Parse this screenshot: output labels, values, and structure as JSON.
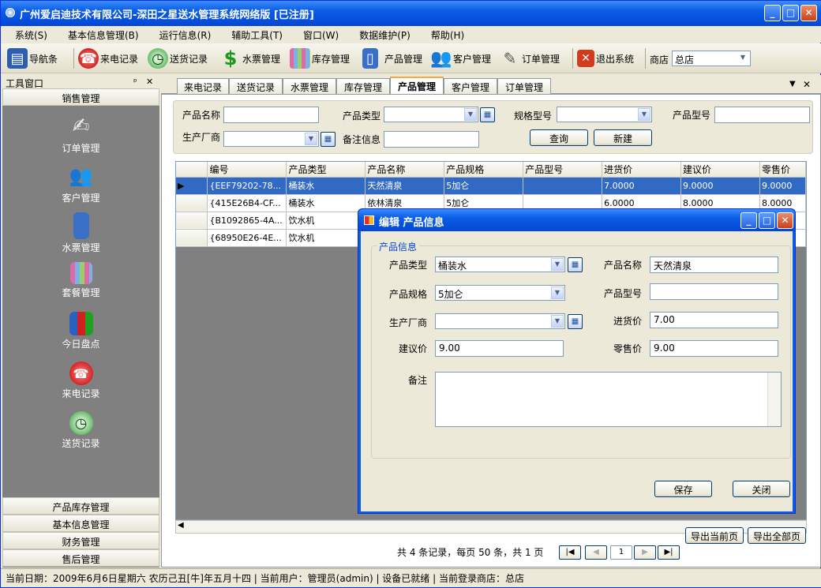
{
  "window": {
    "title": "广州爱启迪技术有限公司-深田之星送水管理系统网络版 [已注册]"
  },
  "menu": [
    "系统(S)",
    "基本信息管理(B)",
    "运行信息(R)",
    "辅助工具(T)",
    "窗口(W)",
    "数据维护(P)",
    "帮助(H)"
  ],
  "toolbar": {
    "nav": "导航条",
    "calls": "来电记录",
    "delivery": "送货记录",
    "tickets": "水票管理",
    "stock": "库存管理",
    "products": "产品管理",
    "customers": "客户管理",
    "orders": "订单管理",
    "exit": "退出系统",
    "store_label": "商店",
    "store_value": "总店"
  },
  "left_panel": {
    "title": "工具窗口",
    "group_active": "销售管理",
    "items": [
      "订单管理",
      "客户管理",
      "水票管理",
      "套餐管理",
      "今日盘点",
      "来电记录",
      "送货记录"
    ],
    "groups_bottom": [
      "产品库存管理",
      "基本信息管理",
      "财务管理",
      "售后管理"
    ]
  },
  "tabs": [
    "来电记录",
    "送货记录",
    "水票管理",
    "库存管理",
    "产品管理",
    "客户管理",
    "订单管理"
  ],
  "filter": {
    "name_label": "产品名称",
    "type_label": "产品类型",
    "spec_label": "规格型号",
    "model_label": "产品型号",
    "maker_label": "生产厂商",
    "note_label": "备注信息",
    "query": "查询",
    "new": "新建"
  },
  "grid": {
    "headers": [
      "编号",
      "产品类型",
      "产品名称",
      "产品规格",
      "产品型号",
      "进货价",
      "建议价",
      "零售价"
    ],
    "rows": [
      [
        "{EEF79202-78...",
        "桶装水",
        "天然清泉",
        "5加仑",
        "",
        "7.0000",
        "9.0000",
        "9.0000"
      ],
      [
        "{415E26B4-CF...",
        "桶装水",
        "依林清泉",
        "5加仑",
        "",
        "6.0000",
        "8.0000",
        "8.0000"
      ],
      [
        "{B1092865-4A...",
        "饮水机",
        "",
        "",
        "",
        "",
        "",
        ""
      ],
      [
        "{68950E26-4E...",
        "饮水机",
        "",
        "",
        "",
        "",
        "",
        ""
      ]
    ]
  },
  "pager": {
    "summary": "共 4 条记录，每页 50 条，共 1 页",
    "page": "1",
    "export_page": "导出当前页",
    "export_all": "导出全部页"
  },
  "dialog": {
    "title": "编辑 产品信息",
    "group": "产品信息",
    "type_label": "产品类型",
    "type_value": "桶装水",
    "name_label": "产品名称",
    "name_value": "天然清泉",
    "spec_label": "产品规格",
    "spec_value": "5加仑",
    "model_label": "产品型号",
    "model_value": "",
    "maker_label": "生产厂商",
    "maker_value": "",
    "cost_label": "进货价",
    "cost_value": "7.00",
    "suggest_label": "建议价",
    "suggest_value": "9.00",
    "retail_label": "零售价",
    "retail_value": "9.00",
    "note_label": "备注",
    "save": "保存",
    "close": "关闭"
  },
  "status": "当前日期：2009年6月6日星期六 农历己丑[牛]年五月十四 | 当前用户：管理员(admin) | 设备已就绪 | 当前登录商店：总店"
}
